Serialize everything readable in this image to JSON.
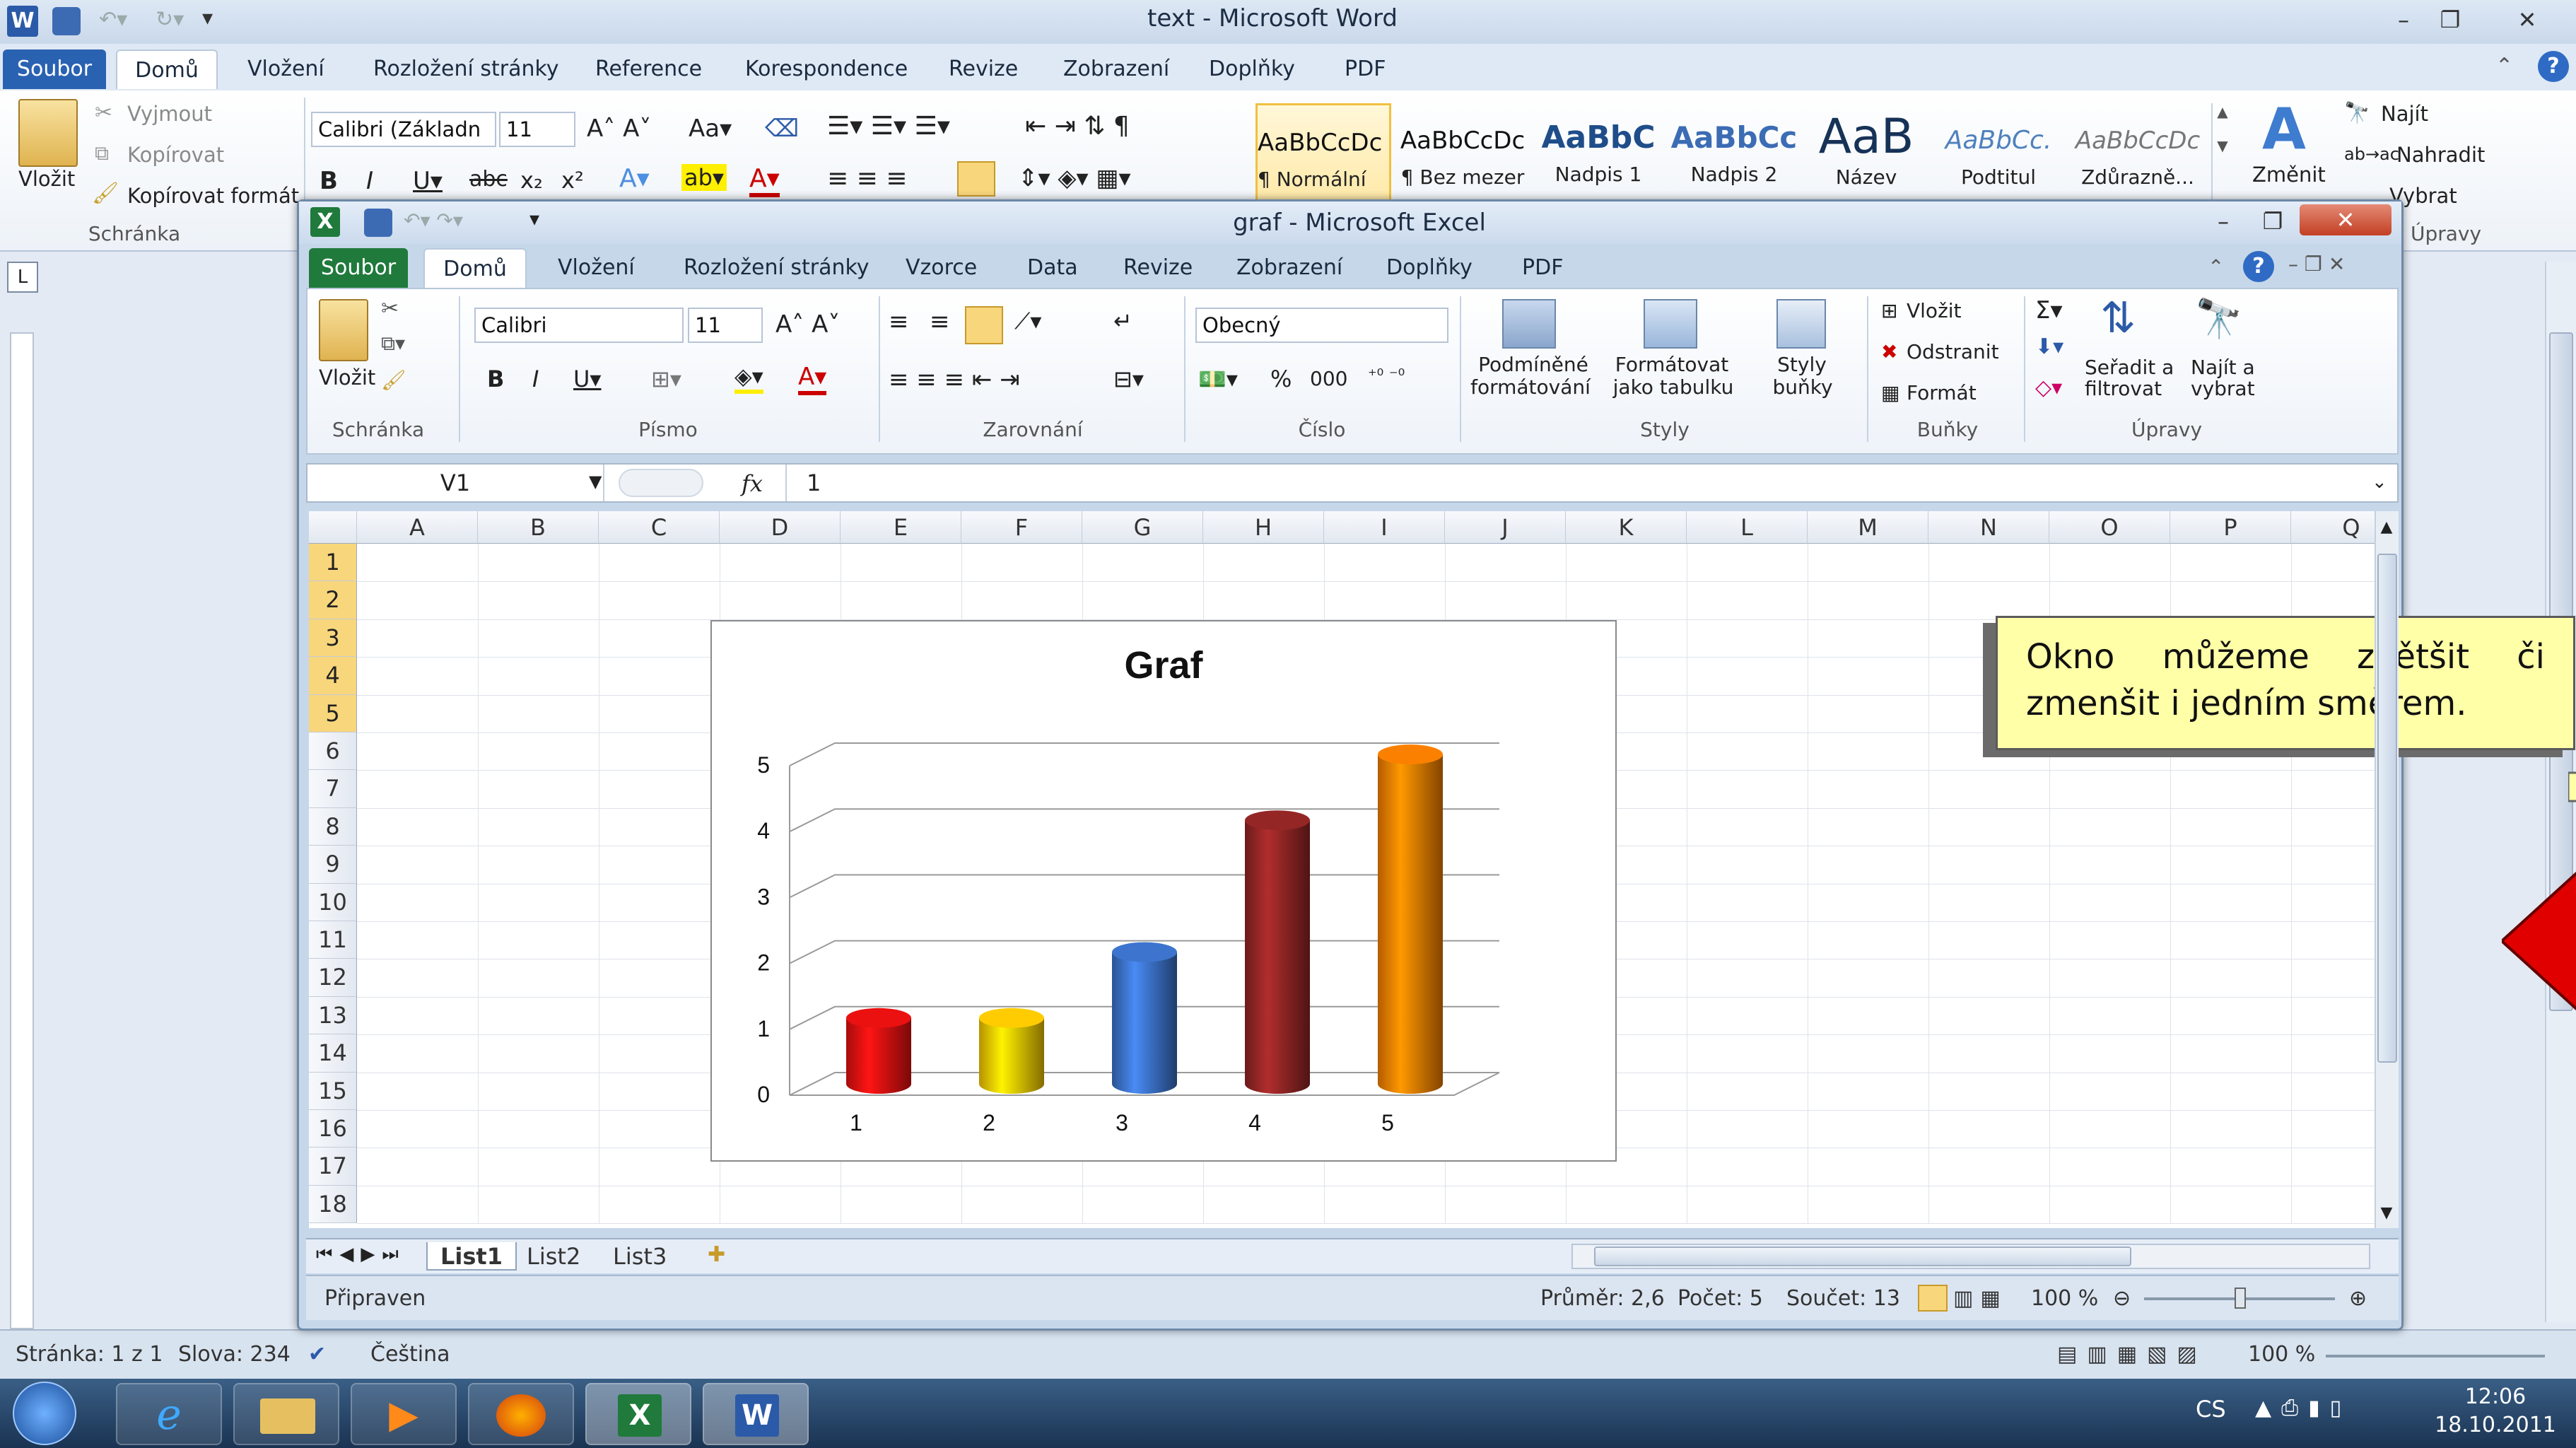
{
  "word": {
    "window_title": "text - Microsoft Word",
    "tabs": [
      "Soubor",
      "Domů",
      "Vložení",
      "Rozložení stránky",
      "Reference",
      "Korespondence",
      "Revize",
      "Zobrazení",
      "Doplňky",
      "PDF"
    ],
    "clipboard": {
      "paste": "Vložit",
      "cut": "Vyjmout",
      "copy": "Kopírovat",
      "format_painter": "Kopírovat formát",
      "group": "Schránka"
    },
    "font_name": "Calibri (Základn",
    "font_size": "11",
    "styles": [
      {
        "sample": "AaBbCcDc",
        "name": "¶ Normální"
      },
      {
        "sample": "AaBbCcDc",
        "name": "¶ Bez mezer"
      },
      {
        "sample": "AaBbC",
        "name": "Nadpis 1"
      },
      {
        "sample": "AaBbCc",
        "name": "Nadpis 2"
      },
      {
        "sample": "AaB",
        "name": "Název"
      },
      {
        "sample": "AaBbCc.",
        "name": "Podtitul"
      },
      {
        "sample": "AaBbCcDc",
        "name": "Zdůrazně..."
      }
    ],
    "change_styles": "Změnit",
    "editing": {
      "find": "Najít",
      "replace": "Nahradit",
      "select": "Vybrat"
    },
    "editing_group": "Úpravy",
    "status": {
      "page": "Stránka: 1 z 1",
      "words": "Slova: 234",
      "language": "Čeština",
      "zoom": "100 %"
    }
  },
  "excel": {
    "window_title": "graf - Microsoft Excel",
    "tabs": [
      "Soubor",
      "Domů",
      "Vložení",
      "Rozložení stránky",
      "Vzorce",
      "Data",
      "Revize",
      "Zobrazení",
      "Doplňky",
      "PDF"
    ],
    "groups": {
      "clipboard": "Schránka",
      "font": "Písmo",
      "alignment": "Zarovnání",
      "number": "Číslo",
      "styles": "Styly",
      "cells": "Buňky",
      "editing": "Úpravy"
    },
    "paste": "Vložit",
    "font_name": "Calibri",
    "font_size": "11",
    "number_format": "Obecný",
    "percent": "%",
    "thousands": "000",
    "styles": {
      "conditional": "Podmíněné",
      "conditional2": "formátování",
      "as_table": "Formátovat",
      "as_table2": "jako tabulku",
      "cell_styles": "Styly",
      "cell_styles2": "buňky"
    },
    "cells": {
      "insert": "Vložit",
      "delete": "Odstranit",
      "format": "Formát"
    },
    "editing": {
      "sort": "Seřadit a",
      "sort2": "filtrovat",
      "find": "Najít a",
      "find2": "vybrat"
    },
    "name_box": "V1",
    "fx": "fx",
    "formula_value": "1",
    "columns": [
      "A",
      "B",
      "C",
      "D",
      "E",
      "F",
      "G",
      "H",
      "I",
      "J",
      "K",
      "L",
      "M",
      "N",
      "O",
      "P",
      "Q"
    ],
    "rows": [
      "1",
      "2",
      "3",
      "4",
      "5",
      "6",
      "7",
      "8",
      "9",
      "10",
      "11",
      "12",
      "13",
      "14",
      "15",
      "16",
      "17",
      "18"
    ],
    "sheet_tabs": [
      "List1",
      "List2",
      "List3"
    ],
    "status": {
      "ready": "Připraven",
      "average": "Průměr: 2,6",
      "count": "Počet: 5",
      "sum": "Součet: 13",
      "zoom": "100 %"
    },
    "callout_text": "Okno můžeme zvětšit či zmenšit i jedním směrem."
  },
  "chart_data": {
    "type": "bar",
    "title": "Graf",
    "categories": [
      "1",
      "2",
      "3",
      "4",
      "5"
    ],
    "values": [
      1,
      1,
      2,
      4,
      5
    ],
    "ylim": [
      0,
      5
    ],
    "yticks": [
      "0",
      "1",
      "2",
      "3",
      "4",
      "5"
    ],
    "colors": [
      "#e01010",
      "#f2c200",
      "#3a6fc4",
      "#8e2424",
      "#f07a00"
    ]
  },
  "taskbar": {
    "language": "CS",
    "time": "12:06",
    "date": "18.10.2011"
  }
}
